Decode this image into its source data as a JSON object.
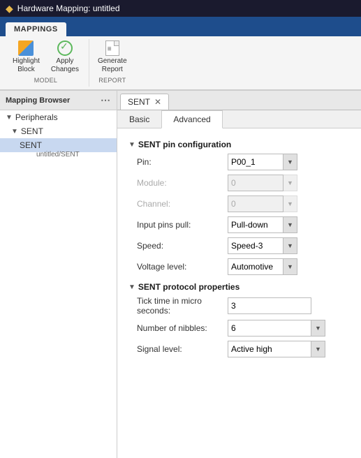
{
  "titleBar": {
    "icon": "◆",
    "title": "Hardware Mapping: untitled"
  },
  "ribbon": {
    "tabs": [
      {
        "label": "MAPPINGS"
      }
    ],
    "buttons": {
      "model_group": {
        "label": "MODEL",
        "items": [
          {
            "id": "highlight-block",
            "label": "Highlight\nBlock",
            "icon": "⬛"
          },
          {
            "id": "apply-changes",
            "label": "Apply\nChanges",
            "icon": "✔"
          }
        ]
      },
      "report_group": {
        "label": "REPORT",
        "items": [
          {
            "id": "generate-report",
            "label": "Generate\nReport",
            "icon": "📄"
          }
        ]
      }
    }
  },
  "sidebar": {
    "title": "Mapping Browser",
    "tree": [
      {
        "level": 0,
        "label": "Peripherals",
        "arrow": "▼",
        "id": "peripherals"
      },
      {
        "level": 1,
        "label": "SENT",
        "arrow": "▼",
        "id": "sent-group"
      },
      {
        "level": 2,
        "label": "SENT",
        "arrow": "",
        "id": "sent-item",
        "selected": true
      },
      {
        "level": 2,
        "sublabel": "untitled/SENT",
        "id": "sent-sublabel"
      }
    ]
  },
  "mainPanel": {
    "tab": {
      "label": "SENT",
      "closable": true
    },
    "subTabs": [
      {
        "label": "Basic",
        "active": false
      },
      {
        "label": "Advanced",
        "active": false
      }
    ],
    "sections": [
      {
        "id": "sent-pin-config",
        "title": "SENT pin configuration",
        "fields": [
          {
            "id": "pin",
            "label": "Pin:",
            "type": "select",
            "value": "P00_1",
            "disabled": false
          },
          {
            "id": "module",
            "label": "Module:",
            "type": "select",
            "value": "0",
            "disabled": true
          },
          {
            "id": "channel",
            "label": "Channel:",
            "type": "select",
            "value": "0",
            "disabled": true
          },
          {
            "id": "input-pins-pull",
            "label": "Input pins pull:",
            "type": "select",
            "value": "Pull-down",
            "disabled": false
          },
          {
            "id": "speed",
            "label": "Speed:",
            "type": "select",
            "value": "Speed-3",
            "disabled": false
          },
          {
            "id": "voltage-level",
            "label": "Voltage level:",
            "type": "select",
            "value": "Automotive",
            "disabled": false
          }
        ]
      },
      {
        "id": "sent-protocol-props",
        "title": "SENT protocol properties",
        "fields": [
          {
            "id": "tick-time",
            "label": "Tick time in micro seconds:",
            "type": "input",
            "value": "3",
            "disabled": false
          },
          {
            "id": "num-nibbles",
            "label": "Number of nibbles:",
            "type": "select",
            "value": "6",
            "disabled": false
          },
          {
            "id": "signal-level",
            "label": "Signal level:",
            "type": "select",
            "value": "Active high",
            "disabled": false
          }
        ]
      }
    ]
  }
}
